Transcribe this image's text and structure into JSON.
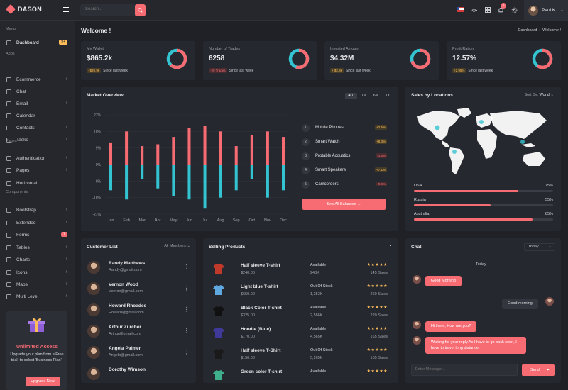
{
  "app": {
    "brand": "DASON"
  },
  "topbar": {
    "search_placeholder": "Search...",
    "notification_count": "5",
    "user_name": "Paul K."
  },
  "sidebar": {
    "sections": [
      "Menu",
      "Apps",
      "Pages",
      "Components"
    ],
    "items": [
      {
        "label": "Dashboard",
        "badge": "9+"
      },
      {
        "label": "Ecommerce"
      },
      {
        "label": "Chat"
      },
      {
        "label": "Email"
      },
      {
        "label": "Calendar"
      },
      {
        "label": "Contacts"
      },
      {
        "label": "Tasks"
      },
      {
        "label": "Authentication"
      },
      {
        "label": "Pages"
      },
      {
        "label": "Horizontal"
      },
      {
        "label": "Bootstrap"
      },
      {
        "label": "Extended"
      },
      {
        "label": "Forms",
        "badge": "7"
      },
      {
        "label": "Tables"
      },
      {
        "label": "Charts"
      },
      {
        "label": "Icons"
      },
      {
        "label": "Maps"
      },
      {
        "label": "Multi Level"
      }
    ],
    "promo": {
      "title": "Unlimited Access",
      "text": "Upgrade your plan from a Free trial, to select 'Business Plan'.",
      "button": "Upgrade Now"
    }
  },
  "page": {
    "title": "Welcome !",
    "breadcrumb": [
      "Dashboard",
      "Welcome !"
    ]
  },
  "stats": [
    {
      "label": "My Wallet",
      "value": "$865.2k",
      "change": "+$20.9k",
      "trend": "pos",
      "note": "Since last week",
      "donut": 0.62
    },
    {
      "label": "Number of Trades",
      "value": "6258",
      "change": "-29 Trades",
      "trend": "neg",
      "note": "Since last week",
      "donut": 0.55
    },
    {
      "label": "Invested Amount",
      "value": "$4.32M",
      "change": "+ $2.8k",
      "trend": "pos",
      "note": "Since last week",
      "donut": 0.7
    },
    {
      "label": "Profit Ration",
      "value": "12.57%",
      "change": "+2.95%",
      "trend": "pos",
      "note": "Since last week",
      "donut": 0.6
    }
  ],
  "market": {
    "title": "Market Overview",
    "tabs": [
      "ALL",
      "1M",
      "6M",
      "1Y"
    ],
    "active_tab": "ALL",
    "legend": [
      {
        "num": "1",
        "label": "Mobile Phones",
        "change": "+2.5%",
        "trend": "pos"
      },
      {
        "num": "2",
        "label": "Smart Watch",
        "change": "+8.3%",
        "trend": "pos"
      },
      {
        "num": "3",
        "label": "Protable Acoustics",
        "change": "-3.6%",
        "trend": "neg"
      },
      {
        "num": "4",
        "label": "Smart Speakers",
        "change": "+7.1%",
        "trend": "pos"
      },
      {
        "num": "5",
        "label": "Camcorders",
        "change": "-0.9%",
        "trend": "neg"
      }
    ],
    "button": "See All Balances"
  },
  "chart_data": {
    "type": "bar",
    "categories": [
      "Jan",
      "Feb",
      "Mar",
      "Apr",
      "May",
      "Jun",
      "Jul",
      "Aug",
      "Sep",
      "Oct",
      "Nov",
      "Dec"
    ],
    "series": [
      {
        "values": [
          12,
          18,
          10,
          11,
          15,
          20,
          21,
          18,
          10,
          16,
          18,
          15
        ],
        "color": "#f76b73"
      },
      {
        "values": [
          -14,
          -19,
          -8,
          -13,
          -17,
          -19,
          -24,
          -18,
          -14,
          -8,
          -18,
          -14
        ],
        "color": "#34c3d0"
      }
    ],
    "yticks": [
      "27%",
      "18%",
      "9%",
      "0%",
      "-9%",
      "-18%",
      "-27%"
    ],
    "ylim": [
      -27,
      27
    ]
  },
  "locations": {
    "title": "Sales by Locations",
    "sort_label": "Sort By:",
    "sort_value": "World",
    "rows": [
      {
        "country": "USA",
        "pct": "75%",
        "value": 0.75
      },
      {
        "country": "Russia",
        "pct": "55%",
        "value": 0.55
      },
      {
        "country": "Australia",
        "pct": "85%",
        "value": 0.85
      }
    ]
  },
  "customers": {
    "title": "Customer List",
    "filter": "All Members",
    "rows": [
      {
        "name": "Randy Matthews",
        "email": "Randy@gmail.com"
      },
      {
        "name": "Vernon Wood",
        "email": "Vernon@gmail.com"
      },
      {
        "name": "Howard Rhoades",
        "email": "Howard@gmail.com"
      },
      {
        "name": "Arthur Zurcher",
        "email": "Arthur@gmail.com"
      },
      {
        "name": "Angela Palmer",
        "email": "Angela@gmail.com"
      },
      {
        "name": "Dorothy Wimson",
        "email": ""
      }
    ]
  },
  "products": {
    "title": "Selling Products",
    "rows": [
      {
        "name": "Half sleeve T-shirt",
        "price": "$240.00",
        "stock": "Available",
        "qty": "243K",
        "sales": "145 Sales",
        "color": "#c0392b",
        "stars": "★★★★★"
      },
      {
        "name": "Light blue T-shirt",
        "price": "$650.00",
        "stock": "Out Of Stock",
        "qty": "1,253K",
        "sales": "260 Sales",
        "color": "#5fa8e0",
        "stars": "★★★★★"
      },
      {
        "name": "Black Color T-shirt",
        "price": "$325.00",
        "stock": "Available",
        "qty": "2,586K",
        "sales": "220 Sales",
        "color": "#111111",
        "stars": "★★★★★"
      },
      {
        "name": "Hoodie (Blue)",
        "price": "$170.00",
        "stock": "Available",
        "qty": "4,565K",
        "sales": "165 Sales",
        "color": "#3f3a9a",
        "stars": "★★★★★"
      },
      {
        "name": "Half sleeve T-Shirt",
        "price": "$150.00",
        "stock": "Out Of Stock",
        "qty": "5,265K",
        "sales": "165 Sales",
        "color": "#1a1a1a",
        "stars": "★★★★★"
      },
      {
        "name": "Green color T-shirt",
        "price": "",
        "stock": "Available",
        "qty": "",
        "sales": "",
        "color": "#3fae8a",
        "stars": "★★★★★"
      }
    ]
  },
  "chat": {
    "title": "Chat",
    "filter": "Today",
    "day": "Today",
    "messages": [
      {
        "text": "Good Morning",
        "dir": "in"
      },
      {
        "text": "Good morning",
        "dir": "out"
      },
      {
        "text": "Hi there, How are you?",
        "dir": "in"
      },
      {
        "text": "Waiting for your reply.As I have to go back soon, I have to travel long distance.",
        "dir": "in"
      }
    ],
    "input_placeholder": "Enter Message...",
    "send": "Send"
  }
}
